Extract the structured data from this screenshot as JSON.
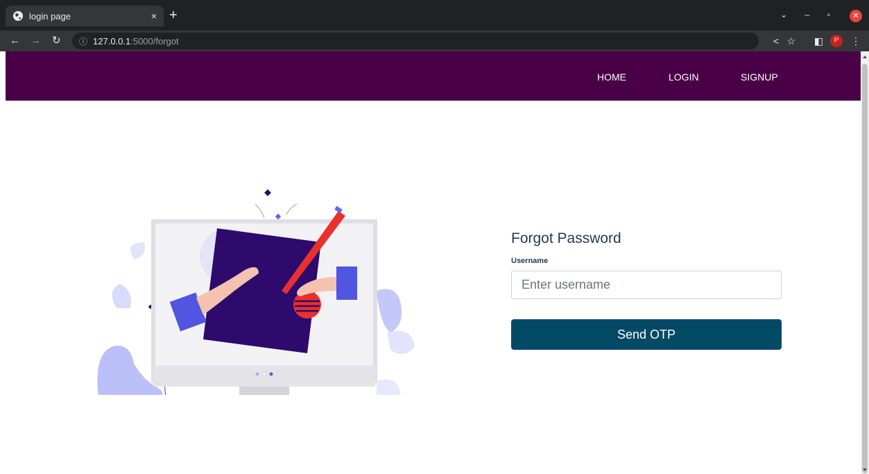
{
  "browser": {
    "tab_title": "login page",
    "tab_close": "×",
    "new_tab": "+",
    "url_host": "127.0.0.1",
    "url_path": ":5000/forgot",
    "profile_initial": "P"
  },
  "nav": {
    "links": [
      "HOME",
      "LOGIN",
      "SIGNUP"
    ]
  },
  "form": {
    "title": "Forgot Password",
    "username_label": "Username",
    "username_placeholder": "Enter username",
    "username_value": "",
    "submit_label": "Send OTP"
  },
  "colors": {
    "navbar": "#4a0047",
    "button": "#034a65",
    "illustration_primary": "#2d0a6b",
    "illustration_accent": "#e8302e"
  }
}
